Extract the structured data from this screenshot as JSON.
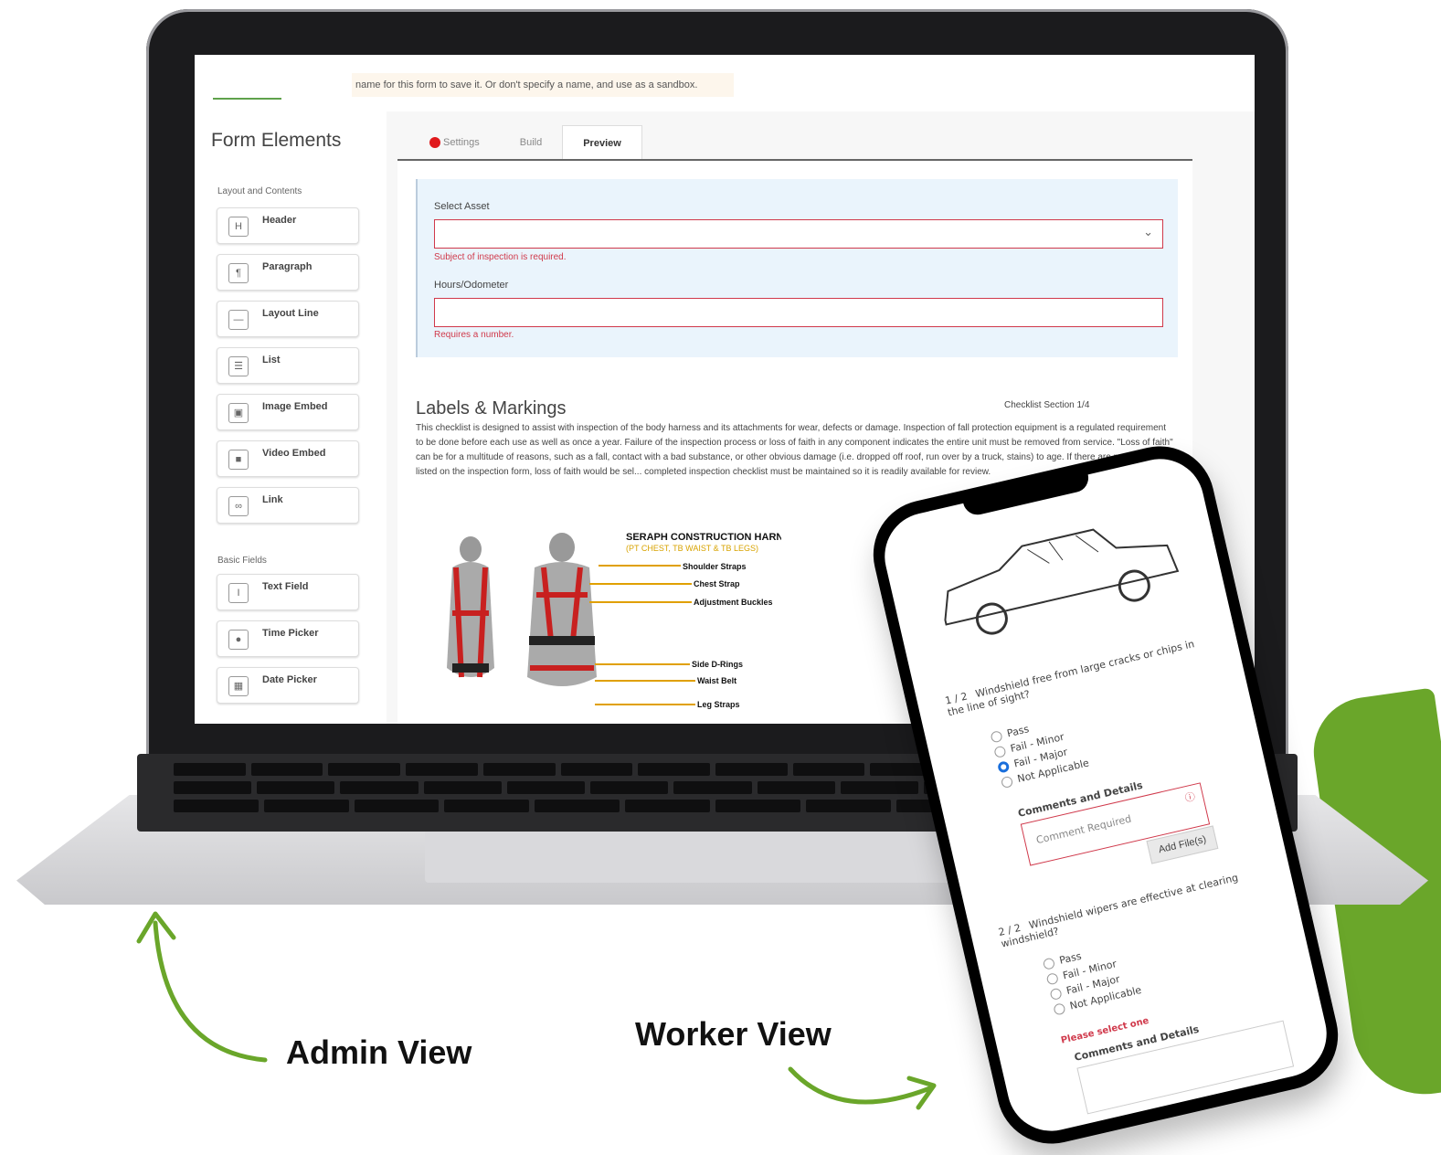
{
  "admin": {
    "notice": "name for this form to save it. Or don't specify a name, and use as a sandbox.",
    "sidebar_title": "Form Elements",
    "sections": {
      "layout": "Layout and Contents",
      "basic": "Basic Fields"
    },
    "elements": [
      {
        "icon": "H",
        "label": "Header"
      },
      {
        "icon": "¶",
        "label": "Paragraph"
      },
      {
        "icon": "—",
        "label": "Layout Line"
      },
      {
        "icon": "☰",
        "label": "List"
      },
      {
        "icon": "▣",
        "label": "Image Embed"
      },
      {
        "icon": "■",
        "label": "Video Embed"
      },
      {
        "icon": "∞",
        "label": "Link"
      }
    ],
    "basic_fields": [
      {
        "icon": "I",
        "label": "Text Field"
      },
      {
        "icon": "●",
        "label": "Time Picker"
      },
      {
        "icon": "▦",
        "label": "Date Picker"
      }
    ],
    "tabs": [
      "Settings",
      "Build",
      "Preview"
    ],
    "form": {
      "select_asset_label": "Select Asset",
      "select_asset_error": "Subject of inspection is required.",
      "hours_label": "Hours/Odometer",
      "hours_error": "Requires a number."
    },
    "labels": {
      "title": "Labels & Markings",
      "section": "Checklist Section 1/4",
      "body": "This checklist is designed to assist with inspection of the body harness and its attachments for wear, defects or damage. Inspection of fall protection equipment is a regulated requirement to be done before each use as well as once a year. Failure of the inspection process or loss of faith in any component indicates the entire unit must be removed from service. \"Loss of faith\" can be for a multitude of reasons, such as a fall, contact with a bad substance, or other obvious damage (i.e. dropped off roof, run over by a truck, stains) to age. If there are reasons not listed on the inspection form, loss of faith would be sel... completed inspection checklist must be maintained so it is readily available for review."
    },
    "harness": {
      "title": "SERAPH CONSTRUCTION HARNESS",
      "subtitle": "(PT CHEST, TB WAIST & TB LEGS)",
      "parts": [
        "Shoulder Straps",
        "Chest Strap",
        "Adjustment Buckles",
        "Side D-Rings",
        "Waist Belt",
        "Leg Straps"
      ]
    }
  },
  "worker": {
    "q1": {
      "num": "1 / 2",
      "text": "Windshield free from large cracks or chips in the line of sight?",
      "options": [
        "Pass",
        "Fail - Minor",
        "Fail - Major",
        "Not Applicable"
      ],
      "selected": 2,
      "comments_label": "Comments and Details",
      "comment_placeholder": "Comment Required",
      "add_file": "Add File(s)"
    },
    "q2": {
      "num": "2 / 2",
      "text": "Windshield wipers are effective at clearing windshield?",
      "options": [
        "Pass",
        "Fail - Minor",
        "Fail - Major",
        "Not Applicable"
      ],
      "error": "Please select one",
      "comments_label": "Comments and Details"
    }
  },
  "captions": {
    "admin": "Admin View",
    "worker": "Worker View"
  },
  "colors": {
    "accent_green": "#6aa62a",
    "error_red": "#d0394b",
    "radio_blue": "#1a6fdc"
  }
}
